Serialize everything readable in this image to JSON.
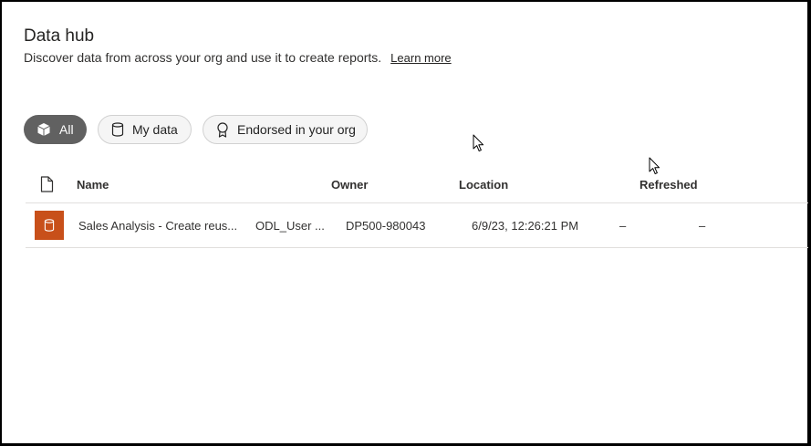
{
  "header": {
    "title": "Data hub",
    "subtitle": "Discover data from across your org and use it to create reports.",
    "learn_more": "Learn more"
  },
  "filters": [
    {
      "label": "All",
      "icon": "cube-icon",
      "selected": true
    },
    {
      "label": "My data",
      "icon": "database-icon",
      "selected": false
    },
    {
      "label": "Endorsed in your org",
      "icon": "ribbon-icon",
      "selected": false
    }
  ],
  "table": {
    "header_icon": "document-icon",
    "columns": [
      "Name",
      "Owner",
      "Location",
      "Refreshed"
    ],
    "rows": [
      {
        "icon": "dataset-icon",
        "name": "Sales Analysis - Create reus...",
        "owner": "ODL_User ...",
        "location": "DP500-980043",
        "refreshed": "6/9/23, 12:26:21 PM",
        "extra1": "–",
        "extra2": "–"
      }
    ]
  },
  "colors": {
    "selected_chip": "#616161",
    "dataset_icon_bg": "#c8501a"
  }
}
